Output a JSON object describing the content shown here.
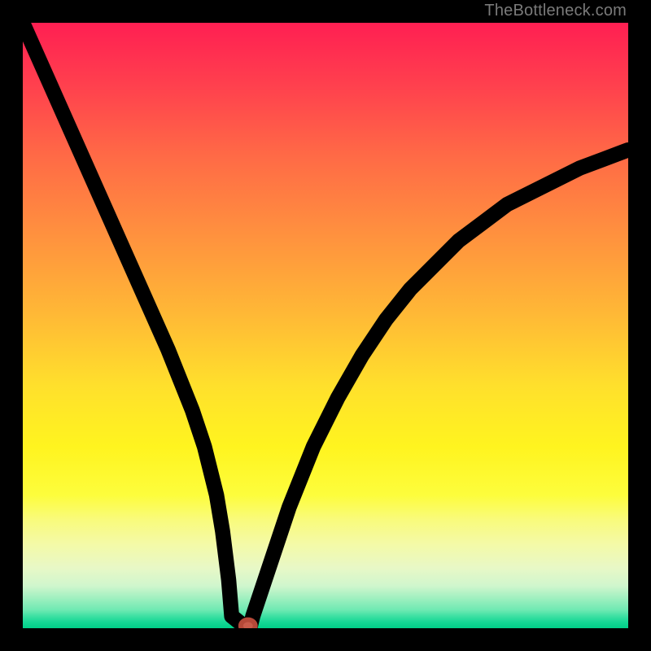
{
  "watermark": "TheBottleneck.com",
  "chart_data": {
    "type": "line",
    "title": "",
    "xlabel": "",
    "ylabel": "",
    "xlim": [
      0,
      100
    ],
    "ylim": [
      0,
      100
    ],
    "grid": false,
    "legend": false,
    "gradient_stops": [
      {
        "pos": 0,
        "color": "#ff1f52"
      },
      {
        "pos": 50,
        "color": "#ffd030"
      },
      {
        "pos": 80,
        "color": "#fbfc70"
      },
      {
        "pos": 95,
        "color": "#9fefbd"
      },
      {
        "pos": 100,
        "color": "#00cf88"
      }
    ],
    "series": [
      {
        "name": "bottleneck-curve",
        "x": [
          0,
          4,
          8,
          12,
          16,
          20,
          24,
          28,
          30,
          32,
          33,
          34,
          34.5,
          37,
          37.5,
          38,
          40,
          44,
          48,
          52,
          56,
          60,
          64,
          68,
          72,
          76,
          80,
          84,
          88,
          92,
          96,
          100
        ],
        "y": [
          100,
          91,
          82,
          73,
          64,
          55,
          46,
          36,
          30,
          22,
          16,
          8,
          2,
          0,
          0,
          2,
          8,
          20,
          30,
          38,
          45,
          51,
          56,
          60,
          64,
          67,
          70,
          72,
          74,
          76,
          77.5,
          79
        ]
      }
    ],
    "marker": {
      "x": 37.2,
      "y": 0.4,
      "color": "#c95b4a"
    }
  }
}
